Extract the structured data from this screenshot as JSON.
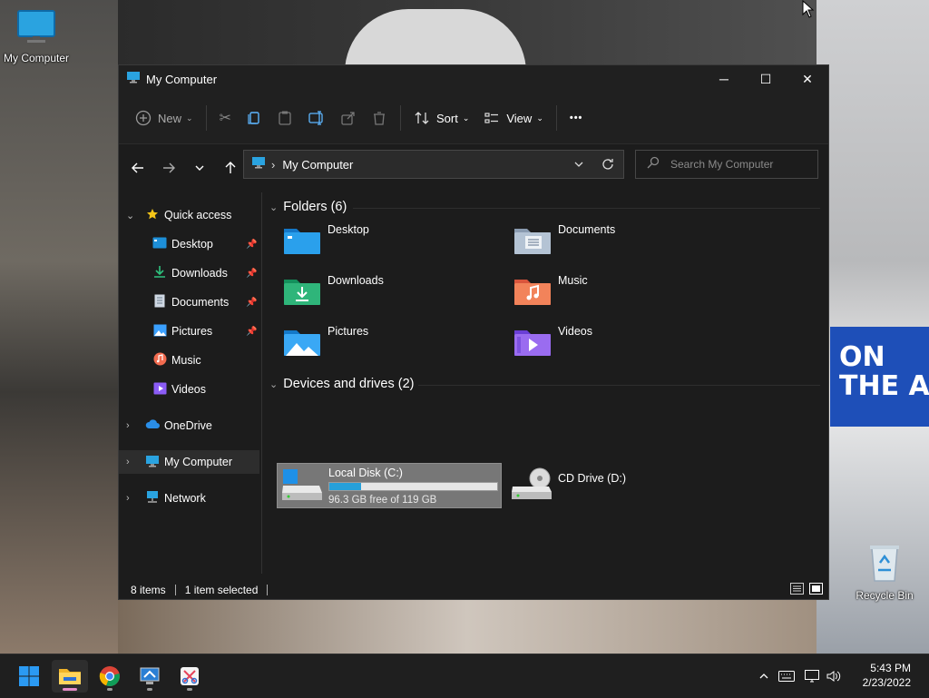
{
  "desktop": {
    "my_computer_label": "My Computer",
    "recycle_bin_label": "Recycle Bin",
    "poster_text": "ON\nTHE A"
  },
  "window": {
    "title": "My Computer",
    "controls": {
      "minimize": "─",
      "maximize": "☐",
      "close": "✕"
    }
  },
  "toolbar": {
    "new_label": "New",
    "sort_label": "Sort",
    "view_label": "View",
    "more_label": "•••"
  },
  "address": {
    "path": "My Computer",
    "separator": "›"
  },
  "search": {
    "placeholder": "Search My Computer"
  },
  "sidebar": {
    "quick_access": "Quick access",
    "items": [
      {
        "label": "Desktop",
        "icon": "desktop-icon",
        "pinned": true
      },
      {
        "label": "Downloads",
        "icon": "download-icon",
        "pinned": true
      },
      {
        "label": "Documents",
        "icon": "document-icon",
        "pinned": true
      },
      {
        "label": "Pictures",
        "icon": "pictures-icon",
        "pinned": true
      },
      {
        "label": "Music",
        "icon": "music-icon",
        "pinned": false
      },
      {
        "label": "Videos",
        "icon": "video-icon",
        "pinned": false
      }
    ],
    "onedrive": "OneDrive",
    "my_computer": "My Computer",
    "network": "Network"
  },
  "content": {
    "folders_header": "Folders (6)",
    "folders": [
      {
        "label": "Desktop",
        "icon": "desktop-folder-icon"
      },
      {
        "label": "Documents",
        "icon": "documents-folder-icon"
      },
      {
        "label": "Downloads",
        "icon": "downloads-folder-icon"
      },
      {
        "label": "Music",
        "icon": "music-folder-icon"
      },
      {
        "label": "Pictures",
        "icon": "pictures-folder-icon"
      },
      {
        "label": "Videos",
        "icon": "videos-folder-icon"
      }
    ],
    "devices_header": "Devices and drives (2)",
    "drives": [
      {
        "label": "Local Disk (C:)",
        "free_text": "96.3 GB free of 119 GB",
        "used_fraction": 0.19,
        "selected": true
      },
      {
        "label": "CD Drive (D:)"
      }
    ]
  },
  "status": {
    "items_count": "8 items",
    "selected": "1 item selected"
  },
  "colors": {
    "accent": "#26a0da",
    "window_bg": "#1c1c1c",
    "selected_bg": "#777777"
  },
  "taskbar": {
    "apps": [
      "start-icon",
      "file-explorer-icon",
      "chrome-icon",
      "remote-desktop-icon",
      "snipping-tool-icon"
    ],
    "time": "5:43 PM",
    "date": "2/23/2022"
  }
}
